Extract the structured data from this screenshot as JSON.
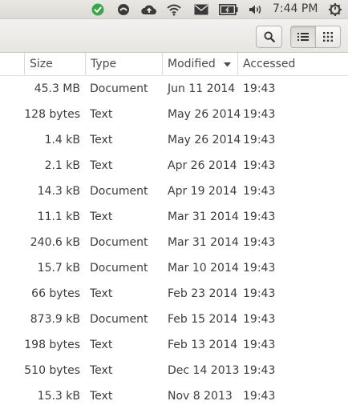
{
  "panel": {
    "icons": [
      "check-icon",
      "power-app-icon",
      "cloud-upload-icon",
      "wifi-icon",
      "mail-icon",
      "battery-icon",
      "volume-icon",
      "gear-power-icon"
    ],
    "clock": "7:44 PM",
    "accent_check": "#3aa54a"
  },
  "toolbar": {
    "buttons": [
      "search-button",
      "list-view-button",
      "grid-view-button"
    ]
  },
  "columns": {
    "size": "Size",
    "type": "Type",
    "modified": "Modified",
    "accessed": "Accessed",
    "sorted_by": "modified",
    "sort_direction": "descending"
  },
  "rows": [
    {
      "size": "45.3 MB",
      "type": "Document",
      "modified": "Jun 11 2014",
      "accessed": "19:43"
    },
    {
      "size": "128 bytes",
      "type": "Text",
      "modified": "May 26 2014",
      "accessed": "19:43"
    },
    {
      "size": "1.4 kB",
      "type": "Text",
      "modified": "May 26 2014",
      "accessed": "19:43"
    },
    {
      "size": "2.1 kB",
      "type": "Text",
      "modified": "Apr 26 2014",
      "accessed": "19:43"
    },
    {
      "size": "14.3 kB",
      "type": "Document",
      "modified": "Apr 19 2014",
      "accessed": "19:43"
    },
    {
      "size": "11.1 kB",
      "type": "Text",
      "modified": "Mar 31 2014",
      "accessed": "19:43"
    },
    {
      "size": "240.6 kB",
      "type": "Document",
      "modified": "Mar 31 2014",
      "accessed": "19:43"
    },
    {
      "size": "15.7 kB",
      "type": "Document",
      "modified": "Mar 10 2014",
      "accessed": "19:43"
    },
    {
      "size": "66 bytes",
      "type": "Text",
      "modified": "Feb 23 2014",
      "accessed": "19:43"
    },
    {
      "size": "873.9 kB",
      "type": "Document",
      "modified": "Feb 15 2014",
      "accessed": "19:43"
    },
    {
      "size": "198 bytes",
      "type": "Text",
      "modified": "Feb 13 2014",
      "accessed": "19:43"
    },
    {
      "size": "510 bytes",
      "type": "Text",
      "modified": "Dec 14 2013",
      "accessed": "19:43"
    },
    {
      "size": "15.3 kB",
      "type": "Text",
      "modified": "Nov 8 2013",
      "accessed": "19:43"
    }
  ]
}
